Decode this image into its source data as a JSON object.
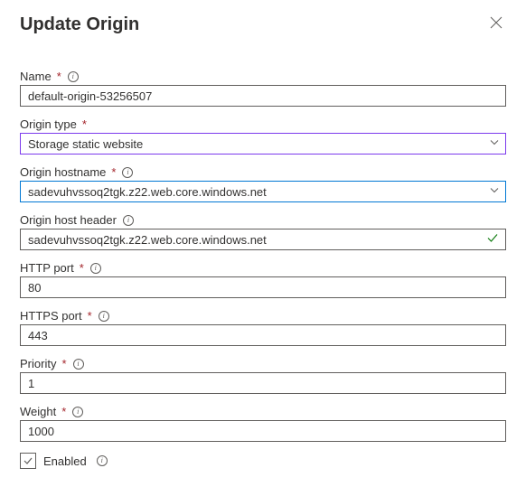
{
  "title": "Update Origin",
  "fields": {
    "name": {
      "label": "Name",
      "value": "default-origin-53256507",
      "required": true,
      "info": true
    },
    "origin_type": {
      "label": "Origin type",
      "value": "Storage static website",
      "required": true,
      "info": false
    },
    "hostname": {
      "label": "Origin hostname",
      "value": "sadevuhvssoq2tgk.z22.web.core.windows.net",
      "required": true,
      "info": true
    },
    "host_header": {
      "label": "Origin host header",
      "value": "sadevuhvssoq2tgk.z22.web.core.windows.net",
      "required": false,
      "info": true
    },
    "http_port": {
      "label": "HTTP port",
      "value": "80",
      "required": true,
      "info": true
    },
    "https_port": {
      "label": "HTTPS port",
      "value": "443",
      "required": true,
      "info": true
    },
    "priority": {
      "label": "Priority",
      "value": "1",
      "required": true,
      "info": true
    },
    "weight": {
      "label": "Weight",
      "value": "1000",
      "required": true,
      "info": true
    },
    "enabled": {
      "label": "Enabled",
      "checked": true,
      "info": true
    }
  }
}
